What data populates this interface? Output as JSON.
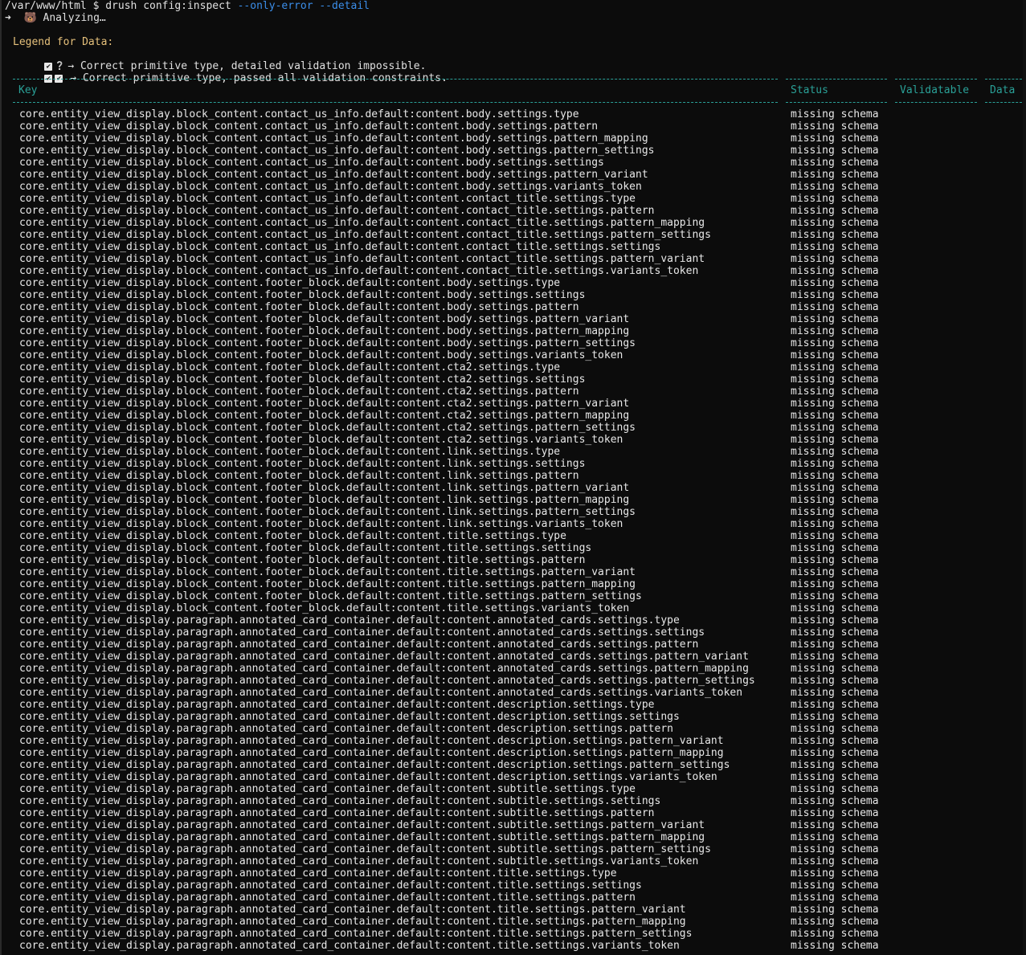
{
  "prompt": {
    "path": "/var/www/html $ ",
    "command": "drush config:inspect ",
    "flag1": "--only-error",
    "flag2": "--detail"
  },
  "analyzing": "➜  🐻 Analyzing…",
  "legend": {
    "title": "Legend for Data:",
    "row1_text": "→ Correct primitive type, detailed validation impossible.",
    "row2_text": "→ Correct primitive type, passed all validation constraints.",
    "check_glyph": "✔",
    "question_glyph": "❔"
  },
  "table": {
    "headers": {
      "key": "Key",
      "status": "Status",
      "validatable": "Validatable",
      "data": "Data"
    },
    "rows": [
      {
        "key": "core.entity_view_display.block_content.contact_us_info.default:content.body.settings.type",
        "status": "missing schema"
      },
      {
        "key": "core.entity_view_display.block_content.contact_us_info.default:content.body.settings.pattern",
        "status": "missing schema"
      },
      {
        "key": "core.entity_view_display.block_content.contact_us_info.default:content.body.settings.pattern_mapping",
        "status": "missing schema"
      },
      {
        "key": "core.entity_view_display.block_content.contact_us_info.default:content.body.settings.pattern_settings",
        "status": "missing schema"
      },
      {
        "key": "core.entity_view_display.block_content.contact_us_info.default:content.body.settings.settings",
        "status": "missing schema"
      },
      {
        "key": "core.entity_view_display.block_content.contact_us_info.default:content.body.settings.pattern_variant",
        "status": "missing schema"
      },
      {
        "key": "core.entity_view_display.block_content.contact_us_info.default:content.body.settings.variants_token",
        "status": "missing schema"
      },
      {
        "key": "core.entity_view_display.block_content.contact_us_info.default:content.contact_title.settings.type",
        "status": "missing schema"
      },
      {
        "key": "core.entity_view_display.block_content.contact_us_info.default:content.contact_title.settings.pattern",
        "status": "missing schema"
      },
      {
        "key": "core.entity_view_display.block_content.contact_us_info.default:content.contact_title.settings.pattern_mapping",
        "status": "missing schema"
      },
      {
        "key": "core.entity_view_display.block_content.contact_us_info.default:content.contact_title.settings.pattern_settings",
        "status": "missing schema"
      },
      {
        "key": "core.entity_view_display.block_content.contact_us_info.default:content.contact_title.settings.settings",
        "status": "missing schema"
      },
      {
        "key": "core.entity_view_display.block_content.contact_us_info.default:content.contact_title.settings.pattern_variant",
        "status": "missing schema"
      },
      {
        "key": "core.entity_view_display.block_content.contact_us_info.default:content.contact_title.settings.variants_token",
        "status": "missing schema"
      },
      {
        "key": "core.entity_view_display.block_content.footer_block.default:content.body.settings.type",
        "status": "missing schema"
      },
      {
        "key": "core.entity_view_display.block_content.footer_block.default:content.body.settings.settings",
        "status": "missing schema"
      },
      {
        "key": "core.entity_view_display.block_content.footer_block.default:content.body.settings.pattern",
        "status": "missing schema"
      },
      {
        "key": "core.entity_view_display.block_content.footer_block.default:content.body.settings.pattern_variant",
        "status": "missing schema"
      },
      {
        "key": "core.entity_view_display.block_content.footer_block.default:content.body.settings.pattern_mapping",
        "status": "missing schema"
      },
      {
        "key": "core.entity_view_display.block_content.footer_block.default:content.body.settings.pattern_settings",
        "status": "missing schema"
      },
      {
        "key": "core.entity_view_display.block_content.footer_block.default:content.body.settings.variants_token",
        "status": "missing schema"
      },
      {
        "key": "core.entity_view_display.block_content.footer_block.default:content.cta2.settings.type",
        "status": "missing schema"
      },
      {
        "key": "core.entity_view_display.block_content.footer_block.default:content.cta2.settings.settings",
        "status": "missing schema"
      },
      {
        "key": "core.entity_view_display.block_content.footer_block.default:content.cta2.settings.pattern",
        "status": "missing schema"
      },
      {
        "key": "core.entity_view_display.block_content.footer_block.default:content.cta2.settings.pattern_variant",
        "status": "missing schema"
      },
      {
        "key": "core.entity_view_display.block_content.footer_block.default:content.cta2.settings.pattern_mapping",
        "status": "missing schema"
      },
      {
        "key": "core.entity_view_display.block_content.footer_block.default:content.cta2.settings.pattern_settings",
        "status": "missing schema"
      },
      {
        "key": "core.entity_view_display.block_content.footer_block.default:content.cta2.settings.variants_token",
        "status": "missing schema"
      },
      {
        "key": "core.entity_view_display.block_content.footer_block.default:content.link.settings.type",
        "status": "missing schema"
      },
      {
        "key": "core.entity_view_display.block_content.footer_block.default:content.link.settings.settings",
        "status": "missing schema"
      },
      {
        "key": "core.entity_view_display.block_content.footer_block.default:content.link.settings.pattern",
        "status": "missing schema"
      },
      {
        "key": "core.entity_view_display.block_content.footer_block.default:content.link.settings.pattern_variant",
        "status": "missing schema"
      },
      {
        "key": "core.entity_view_display.block_content.footer_block.default:content.link.settings.pattern_mapping",
        "status": "missing schema"
      },
      {
        "key": "core.entity_view_display.block_content.footer_block.default:content.link.settings.pattern_settings",
        "status": "missing schema"
      },
      {
        "key": "core.entity_view_display.block_content.footer_block.default:content.link.settings.variants_token",
        "status": "missing schema"
      },
      {
        "key": "core.entity_view_display.block_content.footer_block.default:content.title.settings.type",
        "status": "missing schema"
      },
      {
        "key": "core.entity_view_display.block_content.footer_block.default:content.title.settings.settings",
        "status": "missing schema"
      },
      {
        "key": "core.entity_view_display.block_content.footer_block.default:content.title.settings.pattern",
        "status": "missing schema"
      },
      {
        "key": "core.entity_view_display.block_content.footer_block.default:content.title.settings.pattern_variant",
        "status": "missing schema"
      },
      {
        "key": "core.entity_view_display.block_content.footer_block.default:content.title.settings.pattern_mapping",
        "status": "missing schema"
      },
      {
        "key": "core.entity_view_display.block_content.footer_block.default:content.title.settings.pattern_settings",
        "status": "missing schema"
      },
      {
        "key": "core.entity_view_display.block_content.footer_block.default:content.title.settings.variants_token",
        "status": "missing schema"
      },
      {
        "key": "core.entity_view_display.paragraph.annotated_card_container.default:content.annotated_cards.settings.type",
        "status": "missing schema"
      },
      {
        "key": "core.entity_view_display.paragraph.annotated_card_container.default:content.annotated_cards.settings.settings",
        "status": "missing schema"
      },
      {
        "key": "core.entity_view_display.paragraph.annotated_card_container.default:content.annotated_cards.settings.pattern",
        "status": "missing schema"
      },
      {
        "key": "core.entity_view_display.paragraph.annotated_card_container.default:content.annotated_cards.settings.pattern_variant",
        "status": "missing schema"
      },
      {
        "key": "core.entity_view_display.paragraph.annotated_card_container.default:content.annotated_cards.settings.pattern_mapping",
        "status": "missing schema"
      },
      {
        "key": "core.entity_view_display.paragraph.annotated_card_container.default:content.annotated_cards.settings.pattern_settings",
        "status": "missing schema"
      },
      {
        "key": "core.entity_view_display.paragraph.annotated_card_container.default:content.annotated_cards.settings.variants_token",
        "status": "missing schema"
      },
      {
        "key": "core.entity_view_display.paragraph.annotated_card_container.default:content.description.settings.type",
        "status": "missing schema"
      },
      {
        "key": "core.entity_view_display.paragraph.annotated_card_container.default:content.description.settings.settings",
        "status": "missing schema"
      },
      {
        "key": "core.entity_view_display.paragraph.annotated_card_container.default:content.description.settings.pattern",
        "status": "missing schema"
      },
      {
        "key": "core.entity_view_display.paragraph.annotated_card_container.default:content.description.settings.pattern_variant",
        "status": "missing schema"
      },
      {
        "key": "core.entity_view_display.paragraph.annotated_card_container.default:content.description.settings.pattern_mapping",
        "status": "missing schema"
      },
      {
        "key": "core.entity_view_display.paragraph.annotated_card_container.default:content.description.settings.pattern_settings",
        "status": "missing schema"
      },
      {
        "key": "core.entity_view_display.paragraph.annotated_card_container.default:content.description.settings.variants_token",
        "status": "missing schema"
      },
      {
        "key": "core.entity_view_display.paragraph.annotated_card_container.default:content.subtitle.settings.type",
        "status": "missing schema"
      },
      {
        "key": "core.entity_view_display.paragraph.annotated_card_container.default:content.subtitle.settings.settings",
        "status": "missing schema"
      },
      {
        "key": "core.entity_view_display.paragraph.annotated_card_container.default:content.subtitle.settings.pattern",
        "status": "missing schema"
      },
      {
        "key": "core.entity_view_display.paragraph.annotated_card_container.default:content.subtitle.settings.pattern_variant",
        "status": "missing schema"
      },
      {
        "key": "core.entity_view_display.paragraph.annotated_card_container.default:content.subtitle.settings.pattern_mapping",
        "status": "missing schema"
      },
      {
        "key": "core.entity_view_display.paragraph.annotated_card_container.default:content.subtitle.settings.pattern_settings",
        "status": "missing schema"
      },
      {
        "key": "core.entity_view_display.paragraph.annotated_card_container.default:content.subtitle.settings.variants_token",
        "status": "missing schema"
      },
      {
        "key": "core.entity_view_display.paragraph.annotated_card_container.default:content.title.settings.type",
        "status": "missing schema"
      },
      {
        "key": "core.entity_view_display.paragraph.annotated_card_container.default:content.title.settings.settings",
        "status": "missing schema"
      },
      {
        "key": "core.entity_view_display.paragraph.annotated_card_container.default:content.title.settings.pattern",
        "status": "missing schema"
      },
      {
        "key": "core.entity_view_display.paragraph.annotated_card_container.default:content.title.settings.pattern_variant",
        "status": "missing schema"
      },
      {
        "key": "core.entity_view_display.paragraph.annotated_card_container.default:content.title.settings.pattern_mapping",
        "status": "missing schema"
      },
      {
        "key": "core.entity_view_display.paragraph.annotated_card_container.default:content.title.settings.pattern_settings",
        "status": "missing schema"
      },
      {
        "key": "core.entity_view_display.paragraph.annotated_card_container.default:content.title.settings.variants_token",
        "status": "missing schema"
      }
    ]
  }
}
